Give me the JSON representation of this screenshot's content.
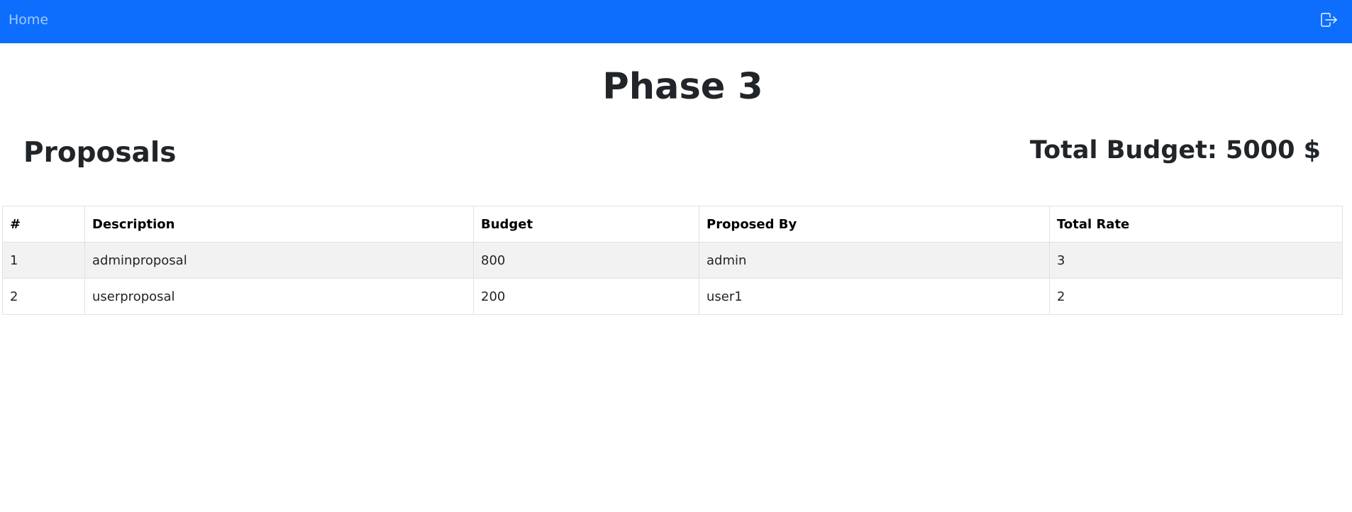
{
  "navbar": {
    "home_label": "Home",
    "logout_icon": "logout-icon",
    "background": "#0d6efd"
  },
  "page": {
    "title": "Phase 3"
  },
  "proposals": {
    "heading": "Proposals",
    "total_budget": "Total Budget: 5000 $",
    "columns": [
      "#",
      "Description",
      "Budget",
      "Proposed By",
      "Total Rate"
    ],
    "rows": [
      [
        "1",
        "adminproposal",
        "800",
        "admin",
        "3"
      ],
      [
        "2",
        "userproposal",
        "200",
        "user1",
        "2"
      ]
    ]
  }
}
